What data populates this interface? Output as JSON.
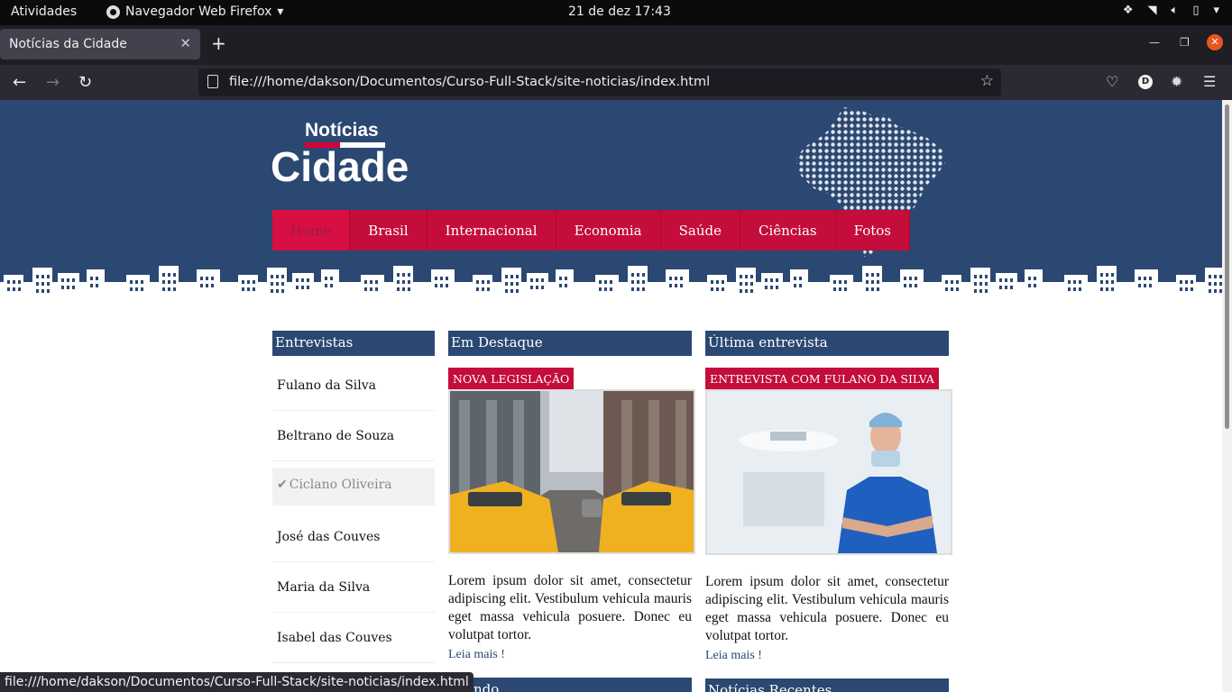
{
  "system": {
    "activities": "Atividades",
    "app_name": "Navegador Web Firefox",
    "clock": "21 de dez  17:43"
  },
  "browser": {
    "tab_title": "Notícias da Cidade",
    "url": "file:///home/dakson/Documentos/Curso-Full-Stack/site-noticias/index.html",
    "status_url": "file:///home/dakson/Documentos/Curso-Full-Stack/site-noticias/index.html",
    "profile_initial": "D"
  },
  "site": {
    "logo_top": "Notícias",
    "logo_main": "Cidade",
    "menu": [
      {
        "label": "Home",
        "active": true
      },
      {
        "label": "Brasil"
      },
      {
        "label": "Internacional"
      },
      {
        "label": "Economia"
      },
      {
        "label": "Saúde"
      },
      {
        "label": "Ciências"
      },
      {
        "label": "Fotos"
      }
    ],
    "colors": {
      "header_blue": "#2b4872",
      "accent_red": "#c40d3a"
    }
  },
  "entrevistas": {
    "title": "Entrevistas",
    "items": [
      {
        "label": "Fulano da Silva"
      },
      {
        "label": "Beltrano de Souza"
      },
      {
        "label": "Ciclano Oliveira",
        "selected": true
      },
      {
        "label": "José das Couves"
      },
      {
        "label": "Maria da Silva"
      },
      {
        "label": "Isabel das Couves"
      }
    ]
  },
  "destaque": {
    "title": "Em Destaque",
    "tag": "NOVA LEGISLAÇÃO",
    "text": "Lorem ipsum dolor sit amet, consectetur adipiscing elit. Vestibulum vehicula mauris eget massa vehicula posuere. Donec eu volutpat tortor.",
    "read_more": "Leia mais !"
  },
  "ultima": {
    "title": "Última entrevista",
    "tag": "ENTREVISTA COM FULANO DA SILVA",
    "text": "Lorem ipsum dolor sit amet, consectetur adipiscing elit. Vestibulum vehicula mauris eget massa vehicula posuere. Donec eu volutpat tortor.",
    "read_more": "Leia mais !"
  },
  "next_sections": {
    "mundo": "Mundo",
    "recentes": "Notícias Recentes"
  }
}
